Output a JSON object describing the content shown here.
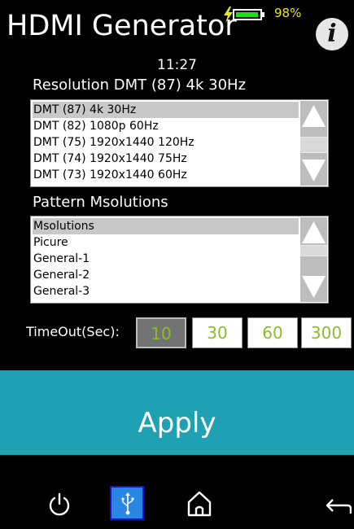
{
  "header": {
    "title": "HDMI Generator",
    "battery_percent_label": "98%",
    "battery_level": 0.98,
    "clock": "11:27",
    "info_icon": "info-icon"
  },
  "resolution": {
    "label": "Resolution DMT (87) 4k 30Hz",
    "items": [
      "DMT (87) 4k 30Hz",
      "DMT (82) 1080p 60Hz",
      "DMT (75) 1920x1440 120Hz",
      "DMT (74) 1920x1440 75Hz",
      "DMT (73) 1920x1440 60Hz"
    ],
    "selected_index": 0
  },
  "pattern": {
    "label": "Pattern Msolutions",
    "items": [
      "Msolutions",
      "Picure",
      "General-1",
      "General-2",
      "General-3"
    ],
    "selected_index": 0
  },
  "timeout": {
    "label": "TimeOut(Sec):",
    "options": [
      "10",
      "30",
      "60",
      "300"
    ],
    "selected": "10"
  },
  "apply_label": "Apply",
  "navbar": {
    "icons": [
      "power-icon",
      "usb-icon",
      "home-icon",
      "back-arrow-icon"
    ]
  },
  "colors": {
    "background": "#000000",
    "apply_button": "#1fa0b3",
    "selected_item": "#c8c8c8",
    "timeout_text": "#8dbb2a",
    "battery_fill": "#1fdc1f",
    "battery_text": "#e8e81a",
    "usb_button": "#2a86e4"
  }
}
